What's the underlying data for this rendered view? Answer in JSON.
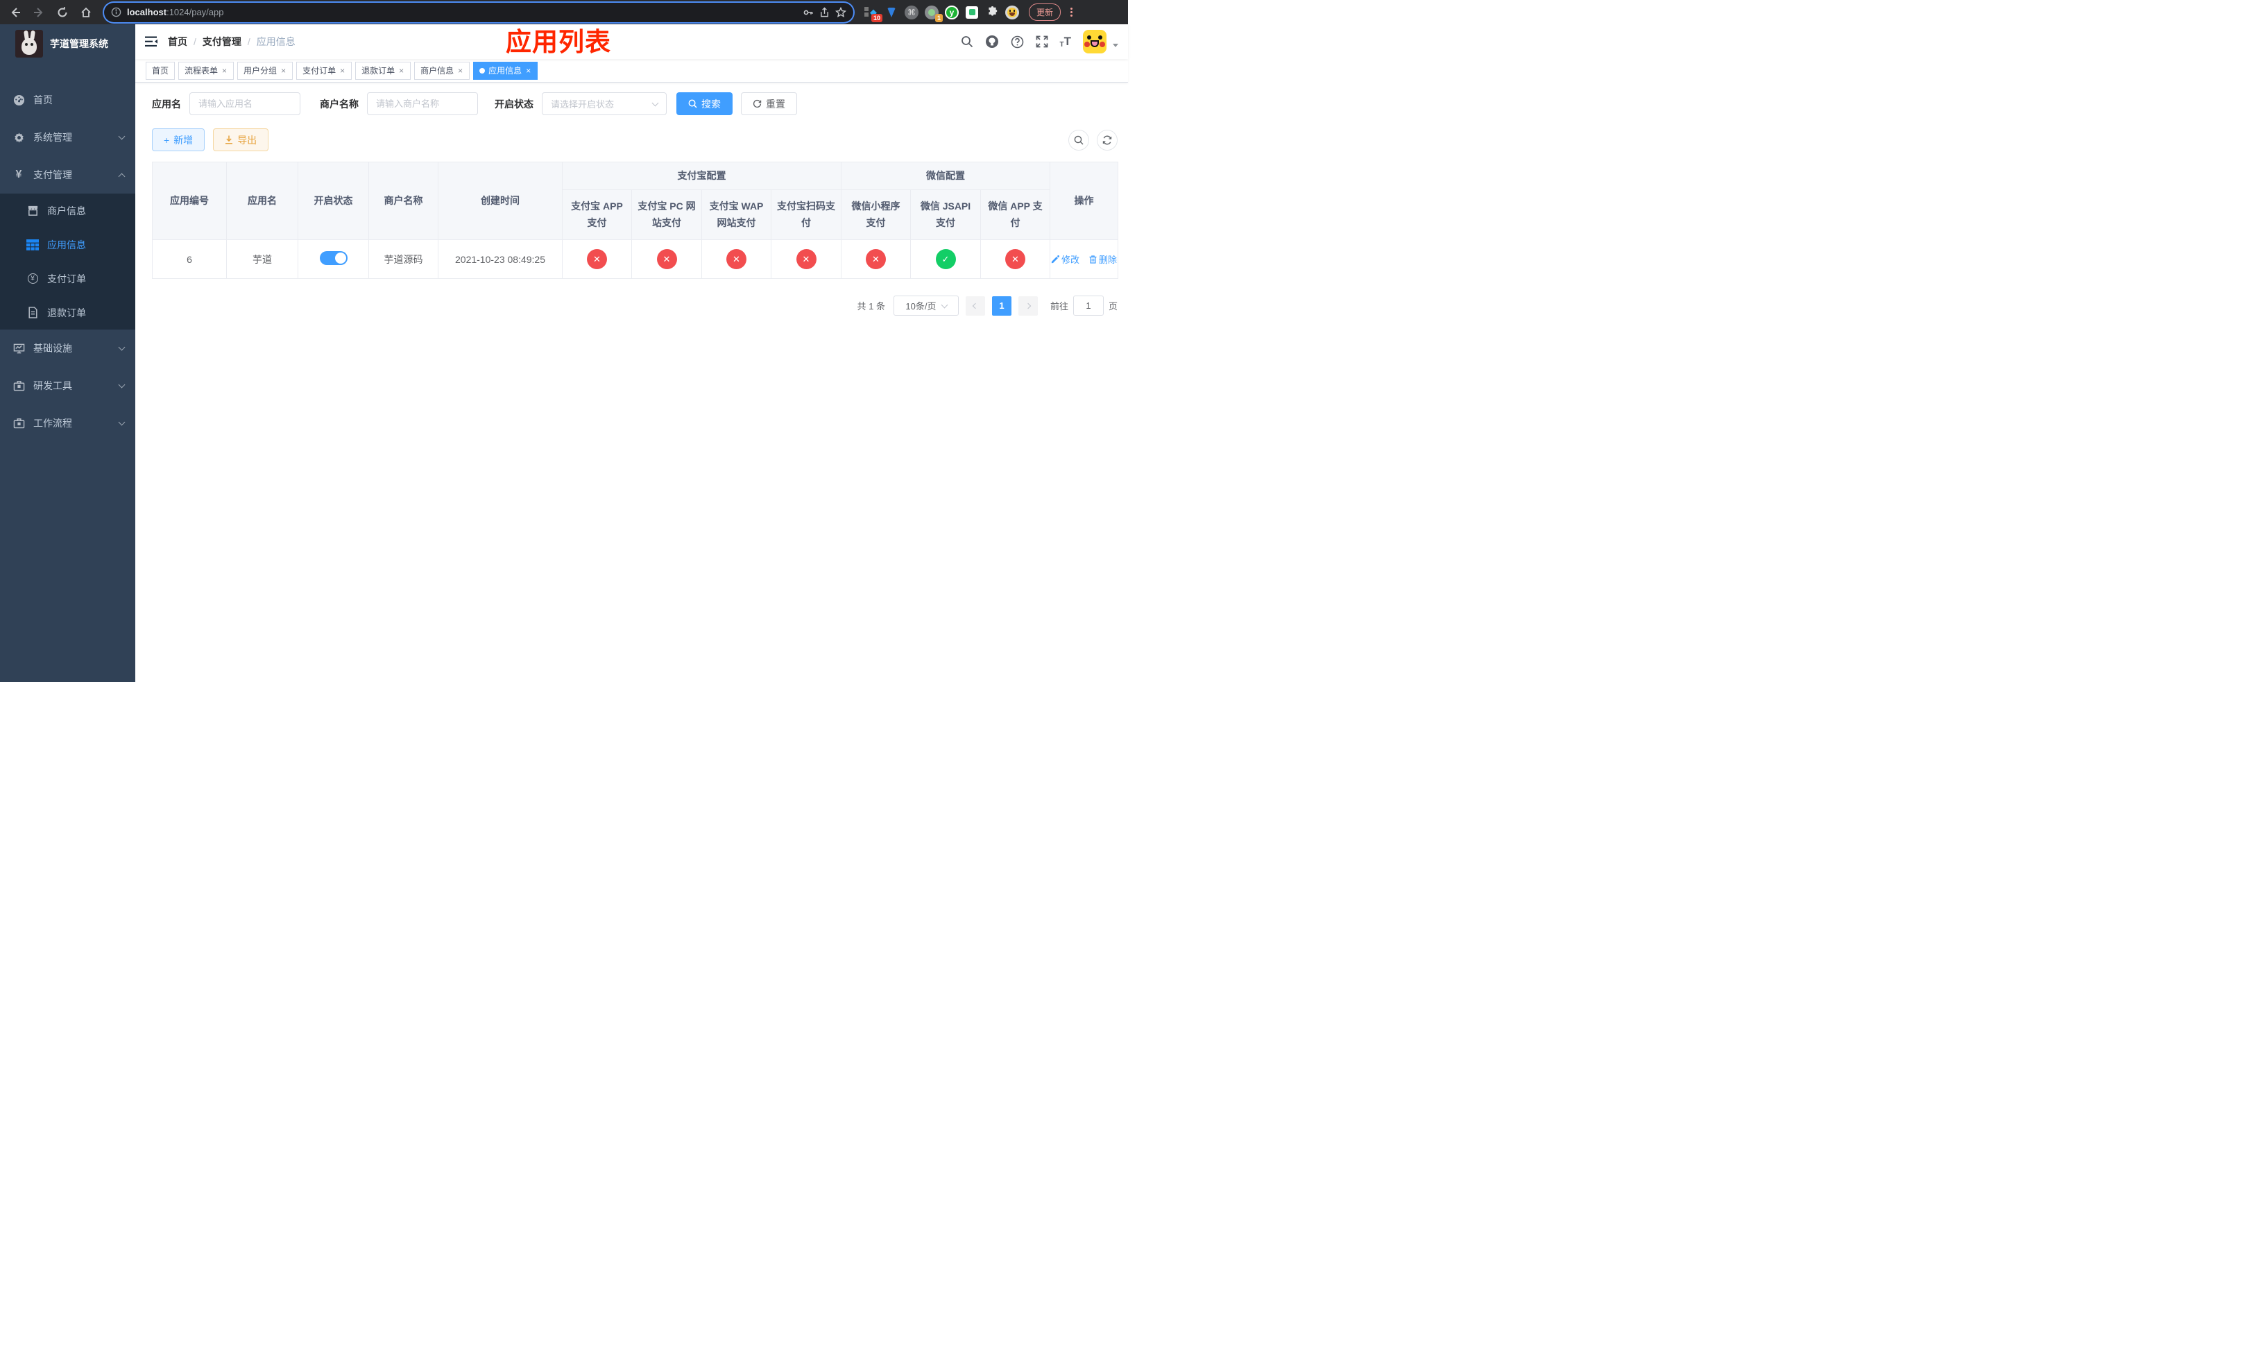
{
  "browser": {
    "url_host": "localhost",
    "url_path": ":1024/pay/app",
    "update_label": "更新",
    "ext_badge_blue": "10",
    "ext_badge_cam": "1",
    "ext_y_letter": "y"
  },
  "sidebar": {
    "logo_title": "芋道管理系统",
    "items": [
      {
        "label": "首页"
      },
      {
        "label": "系统管理"
      },
      {
        "label": "支付管理"
      },
      {
        "label": "基础设施"
      },
      {
        "label": "研发工具"
      },
      {
        "label": "工作流程"
      }
    ],
    "submenu": [
      {
        "label": "商户信息"
      },
      {
        "label": "应用信息"
      },
      {
        "label": "支付订单"
      },
      {
        "label": "退款订单"
      }
    ]
  },
  "header": {
    "breadcrumb": [
      {
        "label": "首页"
      },
      {
        "label": "支付管理"
      },
      {
        "label": "应用信息"
      }
    ],
    "separator": "/",
    "annotation": "应用列表"
  },
  "tabs": [
    {
      "label": "首页"
    },
    {
      "label": "流程表单"
    },
    {
      "label": "用户分组"
    },
    {
      "label": "支付订单"
    },
    {
      "label": "退款订单"
    },
    {
      "label": "商户信息"
    },
    {
      "label": "应用信息"
    }
  ],
  "filters": {
    "app_name_label": "应用名",
    "app_name_placeholder": "请输入应用名",
    "merchant_label": "商户名称",
    "merchant_placeholder": "请输入商户名称",
    "status_label": "开启状态",
    "status_placeholder": "请选择开启状态",
    "search_label": "搜索",
    "reset_label": "重置"
  },
  "toolbar": {
    "add_label": "新增",
    "export_label": "导出"
  },
  "table": {
    "headers": {
      "app_id": "应用编号",
      "app_name": "应用名",
      "status": "开启状态",
      "merchant": "商户名称",
      "created": "创建时间",
      "alipay_group": "支付宝配置",
      "wechat_group": "微信配置",
      "ops": "操作",
      "sub": [
        "支付宝 APP 支付",
        "支付宝 PC 网站支付",
        "支付宝 WAP 网站支付",
        "支付宝扫码支付",
        "微信小程序支付",
        "微信 JSAPI 支付",
        "微信 APP 支付"
      ]
    },
    "row": {
      "app_id": "6",
      "app_name": "芋道",
      "enabled": true,
      "merchant": "芋道源码",
      "created": "2021-10-23 08:49:25",
      "pay_channels": [
        "disabled",
        "disabled",
        "disabled",
        "disabled",
        "disabled",
        "enabled",
        "disabled"
      ],
      "edit_label": "修改",
      "delete_label": "删除"
    }
  },
  "pagination": {
    "total": "共 1 条",
    "page_size": "10条/页",
    "current_page": "1",
    "goto_label": "前往",
    "goto_value": "1",
    "page_suffix": "页"
  },
  "icons": {
    "close_glyph": "×",
    "cross_glyph": "✕",
    "check_glyph": "✓",
    "plus_glyph": "+",
    "yen_glyph": "¥",
    "font_small": "T",
    "font_big": "T",
    "cmd_glyph": "⌘"
  },
  "colors": {
    "accent": "#409eff",
    "danger": "#f24d4f",
    "success": "#13ce66",
    "warning": "#e6a23c",
    "annotation": "#ff2600",
    "sidebar_bg": "#304156",
    "submenu_bg": "#1f2d3d"
  }
}
